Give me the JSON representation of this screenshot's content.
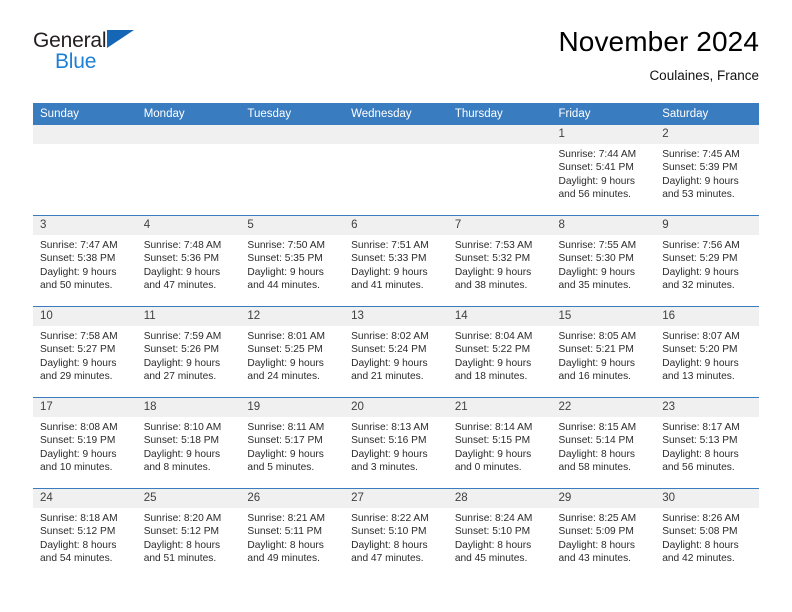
{
  "brand": {
    "word_one": "General",
    "word_two": "Blue",
    "accent_color": "#1d7fd6",
    "triangle_color": "#1567b5"
  },
  "header": {
    "title": "November 2024",
    "location": "Coulaines, France"
  },
  "calendar": {
    "header_bg": "#3a7cc0",
    "daynum_bg": "#f0f0f0",
    "weekday_names": [
      "Sunday",
      "Monday",
      "Tuesday",
      "Wednesday",
      "Thursday",
      "Friday",
      "Saturday"
    ],
    "weeks": [
      [
        {
          "day": "",
          "empty": true
        },
        {
          "day": "",
          "empty": true
        },
        {
          "day": "",
          "empty": true
        },
        {
          "day": "",
          "empty": true
        },
        {
          "day": "",
          "empty": true
        },
        {
          "day": "1",
          "sunrise": "Sunrise: 7:44 AM",
          "sunset": "Sunset: 5:41 PM",
          "daylight1": "Daylight: 9 hours",
          "daylight2": "and 56 minutes."
        },
        {
          "day": "2",
          "sunrise": "Sunrise: 7:45 AM",
          "sunset": "Sunset: 5:39 PM",
          "daylight1": "Daylight: 9 hours",
          "daylight2": "and 53 minutes."
        }
      ],
      [
        {
          "day": "3",
          "sunrise": "Sunrise: 7:47 AM",
          "sunset": "Sunset: 5:38 PM",
          "daylight1": "Daylight: 9 hours",
          "daylight2": "and 50 minutes."
        },
        {
          "day": "4",
          "sunrise": "Sunrise: 7:48 AM",
          "sunset": "Sunset: 5:36 PM",
          "daylight1": "Daylight: 9 hours",
          "daylight2": "and 47 minutes."
        },
        {
          "day": "5",
          "sunrise": "Sunrise: 7:50 AM",
          "sunset": "Sunset: 5:35 PM",
          "daylight1": "Daylight: 9 hours",
          "daylight2": "and 44 minutes."
        },
        {
          "day": "6",
          "sunrise": "Sunrise: 7:51 AM",
          "sunset": "Sunset: 5:33 PM",
          "daylight1": "Daylight: 9 hours",
          "daylight2": "and 41 minutes."
        },
        {
          "day": "7",
          "sunrise": "Sunrise: 7:53 AM",
          "sunset": "Sunset: 5:32 PM",
          "daylight1": "Daylight: 9 hours",
          "daylight2": "and 38 minutes."
        },
        {
          "day": "8",
          "sunrise": "Sunrise: 7:55 AM",
          "sunset": "Sunset: 5:30 PM",
          "daylight1": "Daylight: 9 hours",
          "daylight2": "and 35 minutes."
        },
        {
          "day": "9",
          "sunrise": "Sunrise: 7:56 AM",
          "sunset": "Sunset: 5:29 PM",
          "daylight1": "Daylight: 9 hours",
          "daylight2": "and 32 minutes."
        }
      ],
      [
        {
          "day": "10",
          "sunrise": "Sunrise: 7:58 AM",
          "sunset": "Sunset: 5:27 PM",
          "daylight1": "Daylight: 9 hours",
          "daylight2": "and 29 minutes."
        },
        {
          "day": "11",
          "sunrise": "Sunrise: 7:59 AM",
          "sunset": "Sunset: 5:26 PM",
          "daylight1": "Daylight: 9 hours",
          "daylight2": "and 27 minutes."
        },
        {
          "day": "12",
          "sunrise": "Sunrise: 8:01 AM",
          "sunset": "Sunset: 5:25 PM",
          "daylight1": "Daylight: 9 hours",
          "daylight2": "and 24 minutes."
        },
        {
          "day": "13",
          "sunrise": "Sunrise: 8:02 AM",
          "sunset": "Sunset: 5:24 PM",
          "daylight1": "Daylight: 9 hours",
          "daylight2": "and 21 minutes."
        },
        {
          "day": "14",
          "sunrise": "Sunrise: 8:04 AM",
          "sunset": "Sunset: 5:22 PM",
          "daylight1": "Daylight: 9 hours",
          "daylight2": "and 18 minutes."
        },
        {
          "day": "15",
          "sunrise": "Sunrise: 8:05 AM",
          "sunset": "Sunset: 5:21 PM",
          "daylight1": "Daylight: 9 hours",
          "daylight2": "and 16 minutes."
        },
        {
          "day": "16",
          "sunrise": "Sunrise: 8:07 AM",
          "sunset": "Sunset: 5:20 PM",
          "daylight1": "Daylight: 9 hours",
          "daylight2": "and 13 minutes."
        }
      ],
      [
        {
          "day": "17",
          "sunrise": "Sunrise: 8:08 AM",
          "sunset": "Sunset: 5:19 PM",
          "daylight1": "Daylight: 9 hours",
          "daylight2": "and 10 minutes."
        },
        {
          "day": "18",
          "sunrise": "Sunrise: 8:10 AM",
          "sunset": "Sunset: 5:18 PM",
          "daylight1": "Daylight: 9 hours",
          "daylight2": "and 8 minutes."
        },
        {
          "day": "19",
          "sunrise": "Sunrise: 8:11 AM",
          "sunset": "Sunset: 5:17 PM",
          "daylight1": "Daylight: 9 hours",
          "daylight2": "and 5 minutes."
        },
        {
          "day": "20",
          "sunrise": "Sunrise: 8:13 AM",
          "sunset": "Sunset: 5:16 PM",
          "daylight1": "Daylight: 9 hours",
          "daylight2": "and 3 minutes."
        },
        {
          "day": "21",
          "sunrise": "Sunrise: 8:14 AM",
          "sunset": "Sunset: 5:15 PM",
          "daylight1": "Daylight: 9 hours",
          "daylight2": "and 0 minutes."
        },
        {
          "day": "22",
          "sunrise": "Sunrise: 8:15 AM",
          "sunset": "Sunset: 5:14 PM",
          "daylight1": "Daylight: 8 hours",
          "daylight2": "and 58 minutes."
        },
        {
          "day": "23",
          "sunrise": "Sunrise: 8:17 AM",
          "sunset": "Sunset: 5:13 PM",
          "daylight1": "Daylight: 8 hours",
          "daylight2": "and 56 minutes."
        }
      ],
      [
        {
          "day": "24",
          "sunrise": "Sunrise: 8:18 AM",
          "sunset": "Sunset: 5:12 PM",
          "daylight1": "Daylight: 8 hours",
          "daylight2": "and 54 minutes."
        },
        {
          "day": "25",
          "sunrise": "Sunrise: 8:20 AM",
          "sunset": "Sunset: 5:12 PM",
          "daylight1": "Daylight: 8 hours",
          "daylight2": "and 51 minutes."
        },
        {
          "day": "26",
          "sunrise": "Sunrise: 8:21 AM",
          "sunset": "Sunset: 5:11 PM",
          "daylight1": "Daylight: 8 hours",
          "daylight2": "and 49 minutes."
        },
        {
          "day": "27",
          "sunrise": "Sunrise: 8:22 AM",
          "sunset": "Sunset: 5:10 PM",
          "daylight1": "Daylight: 8 hours",
          "daylight2": "and 47 minutes."
        },
        {
          "day": "28",
          "sunrise": "Sunrise: 8:24 AM",
          "sunset": "Sunset: 5:10 PM",
          "daylight1": "Daylight: 8 hours",
          "daylight2": "and 45 minutes."
        },
        {
          "day": "29",
          "sunrise": "Sunrise: 8:25 AM",
          "sunset": "Sunset: 5:09 PM",
          "daylight1": "Daylight: 8 hours",
          "daylight2": "and 43 minutes."
        },
        {
          "day": "30",
          "sunrise": "Sunrise: 8:26 AM",
          "sunset": "Sunset: 5:08 PM",
          "daylight1": "Daylight: 8 hours",
          "daylight2": "and 42 minutes."
        }
      ]
    ]
  }
}
